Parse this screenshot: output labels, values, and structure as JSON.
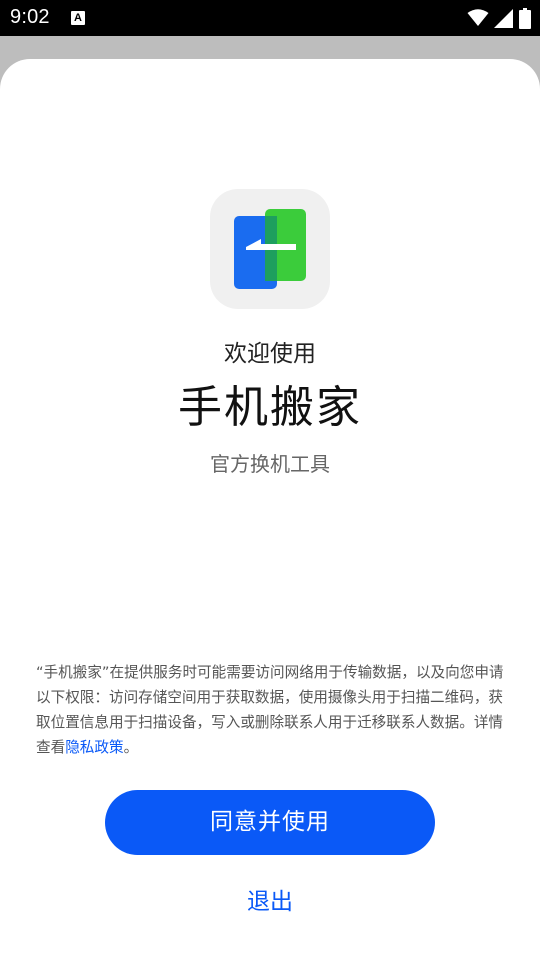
{
  "status_bar": {
    "time": "9:02",
    "notification_icon_letter": "A",
    "icons": [
      "wifi-icon",
      "cellular-signal-icon",
      "battery-icon"
    ]
  },
  "dialog": {
    "app_icon": "phone-transfer-app-icon",
    "welcome_text": "欢迎使用",
    "app_name": "手机搬家",
    "subtitle": "官方换机工具",
    "notice_text": "“手机搬家”在提供服务时可能需要访问网络用于传输数据，以及向您申请以下权限：访问存储空间用于获取数据，使用摄像头用于扫描二维码，获取位置信息用于扫描设备，写入或删除联系人用于迁移联系人数据。详情查看",
    "privacy_link": "隐私政策",
    "notice_end": "。",
    "agree_button": "同意并使用",
    "exit_button": "退出"
  },
  "colors": {
    "accent": "#0a59f7",
    "icon_blue": "#1a6cf0",
    "icon_green": "#3bcc3b",
    "sheet_background": "#ffffff",
    "scrim": "#bdbdbd"
  }
}
